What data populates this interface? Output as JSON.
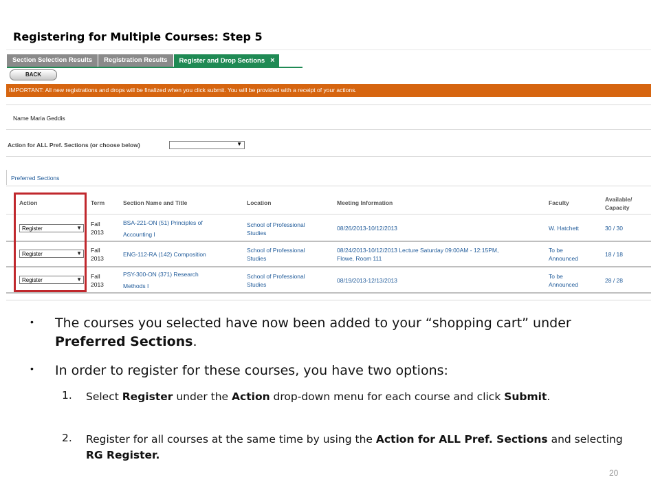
{
  "slide": {
    "title": "Registering for Multiple Courses: Step 5",
    "page_number": "20"
  },
  "tabs": [
    {
      "label": "Section Selection Results",
      "active": false
    },
    {
      "label": "Registration Results",
      "active": false
    },
    {
      "label": "Register and Drop Sections",
      "active": true,
      "close": "×"
    }
  ],
  "back_button": "BACK",
  "important_notice": "IMPORTANT: All new registrations and drops will be finalized when you click submit. You will be provided with a receipt of your actions.",
  "name_label": "Name",
  "name_value": "Maria Geddis",
  "action_all_label": "Action for ALL Pref. Sections (or choose below)",
  "preferred_sections_label": "Preferred Sections",
  "table": {
    "headers": {
      "action": "Action",
      "term": "Term",
      "section": "Section Name and Title",
      "location": "Location",
      "meeting": "Meeting Information",
      "faculty": "Faculty",
      "available_1": "Available/",
      "available_2": "Capacity"
    },
    "rows": [
      {
        "action": "Register",
        "term_1": "Fall",
        "term_2": "2013",
        "section_1": "BSA-221-ON (51) Principles of",
        "section_2": "Accounting I",
        "location_1": "School of Professional",
        "location_2": "Studies",
        "meeting_1": "08/26/2013-10/12/2013",
        "meeting_2": "",
        "faculty_1": "W. Hatchett",
        "faculty_2": "",
        "available": "30 / 30"
      },
      {
        "action": "Register",
        "term_1": "Fall",
        "term_2": "2013",
        "section_1": "ENG-112-RA (142) Composition",
        "section_2": "",
        "location_1": "School of Professional",
        "location_2": "Studies",
        "meeting_1": "08/24/2013-10/12/2013 Lecture Saturday 09:00AM - 12:15PM,",
        "meeting_2": "Flowe, Room 111",
        "faculty_1": "To be",
        "faculty_2": "Announced",
        "available": "18 / 18"
      },
      {
        "action": "Register",
        "term_1": "Fall",
        "term_2": "2013",
        "section_1": "PSY-300-ON (371) Research",
        "section_2": "Methods I",
        "location_1": "School of Professional",
        "location_2": "Studies",
        "meeting_1": "08/19/2013-12/13/2013",
        "meeting_2": "",
        "faculty_1": "To be",
        "faculty_2": "Announced",
        "available": "28 / 28"
      }
    ]
  },
  "bullets": {
    "b1_pre": "The courses you selected have now been added to your “shopping cart” under ",
    "b1_bold": "Preferred Sections",
    "b1_post": ".",
    "b2": "In order to register for these courses, you have two options:",
    "n1_num": "1.",
    "n1_a": "Select ",
    "n1_b": "Register",
    "n1_c": " under the ",
    "n1_d": "Action",
    "n1_e": " drop-down menu for each course and click ",
    "n1_f": "Submit",
    "n1_g": ".",
    "n2_num": "2.",
    "n2_a": "Register for all courses at the same time by using the ",
    "n2_b": "Action for ALL Pref. Sections",
    "n2_c": " and selecting ",
    "n2_d": "RG Register."
  },
  "colors": {
    "active_tab": "#1f8a54",
    "inactive_tab": "#8a8a8a",
    "important_bar": "#d66510",
    "highlight_box": "#c0282d",
    "link": "#1f5a99"
  }
}
